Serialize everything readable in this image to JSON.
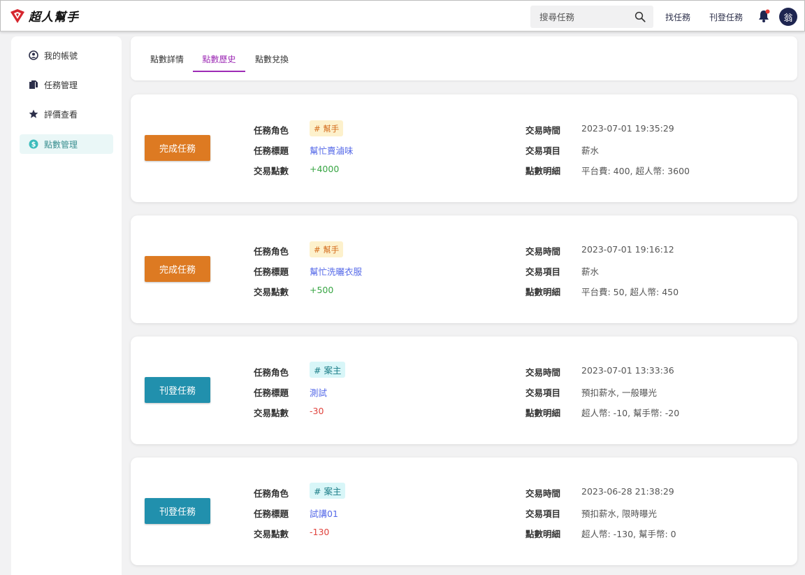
{
  "header": {
    "logo_text": "超人幫手",
    "search": {
      "placeholder": "搜尋任務",
      "value": ""
    },
    "nav": {
      "find_task": "找任務",
      "post_task": "刊登任務"
    },
    "avatar_text": "翁",
    "icons": [
      "logo-icon",
      "search-icon",
      "bell-icon"
    ],
    "colors": {
      "avatar_bg": "#1e2550",
      "notification_dot": "#e53935"
    }
  },
  "sidebar": {
    "items": [
      {
        "label": "我的帳號",
        "icon": "user-circle-icon",
        "active": false
      },
      {
        "label": "任務管理",
        "icon": "documents-icon",
        "active": false
      },
      {
        "label": "評價查看",
        "icon": "star-icon",
        "active": false
      },
      {
        "label": "點數管理",
        "icon": "dollar-circle-icon",
        "active": true
      }
    ],
    "colors": {
      "active_bg": "#eaf7f7",
      "active_text": "#3a8f90"
    }
  },
  "tabs": [
    {
      "label": "點數詳情",
      "active": false
    },
    {
      "label": "點數歷史",
      "active": true
    },
    {
      "label": "點數兌換",
      "active": false
    }
  ],
  "labels": {
    "role": "任務角色",
    "title": "任務標題",
    "points": "交易點數",
    "time": "交易時間",
    "item": "交易項目",
    "detail": "點數明細"
  },
  "transactions": [
    {
      "type_label": "完成任務",
      "role": "# 幫手",
      "title": "幫忙賣滷味",
      "points": "+4000",
      "time": "2023-07-01 19:35:29",
      "item": "薪水",
      "detail": "平台費: 400, 超人幣: 3600"
    },
    {
      "type_label": "完成任務",
      "role": "# 幫手",
      "title": "幫忙洗曬衣服",
      "points": "+500",
      "time": "2023-07-01 19:16:12",
      "item": "薪水",
      "detail": "平台費: 50, 超人幣: 450"
    },
    {
      "type_label": "刊登任務",
      "role": "# 案主",
      "title": "測試",
      "points": "-30",
      "time": "2023-07-01 13:33:36",
      "item": "預扣薪水, 一般曝光",
      "detail": "超人幣: -10, 幫手幣: -20"
    },
    {
      "type_label": "刊登任務",
      "role": "# 案主",
      "title": "試講01",
      "points": "-130",
      "time": "2023-06-28 21:38:29",
      "item": "預扣薪水, 限時曝光",
      "detail": "超人幣: -130, 幫手幣: 0"
    }
  ],
  "colors": {
    "complete_btn": "#dd7a22",
    "post_btn": "#2190ad",
    "active_tab": "#9d2bb5",
    "positive_points": "#37a543",
    "negative_points": "#e0433d",
    "title_link": "#5569e8"
  }
}
